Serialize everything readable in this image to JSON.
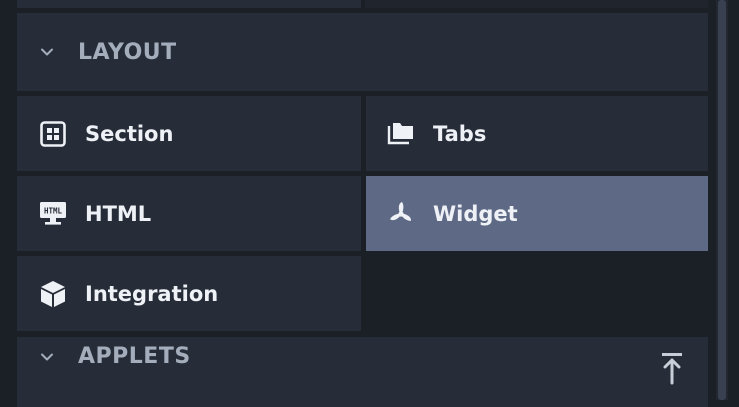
{
  "layout_section": {
    "title": "LAYOUT",
    "items": [
      {
        "label": "Section",
        "icon": "grid-box-icon"
      },
      {
        "label": "Tabs",
        "icon": "folders-icon"
      },
      {
        "label": "HTML",
        "icon": "html-monitor-icon"
      },
      {
        "label": "Widget",
        "icon": "propeller-icon",
        "selected": true
      },
      {
        "label": "Integration",
        "icon": "cube-icon"
      }
    ]
  },
  "applets_section": {
    "title": "APPLETS",
    "action_icon": "scroll-to-top-icon"
  },
  "colors": {
    "background": "#1b1f26",
    "tile": "#262d39",
    "tile_selected": "#5e6a85",
    "header_text": "#a4adbb",
    "tile_text": "#eef1f5"
  }
}
